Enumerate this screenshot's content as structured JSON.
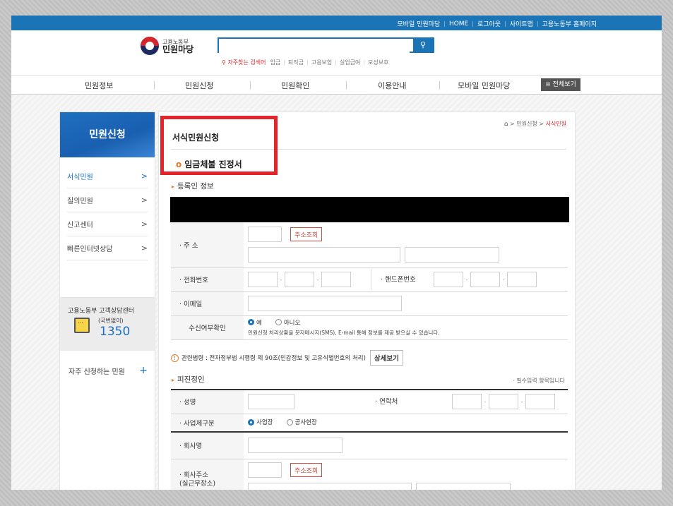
{
  "topbar": {
    "links": [
      "모바일 민원마당",
      "HOME",
      "로그아웃",
      "사이트맵",
      "고용노동부 홈페이지"
    ]
  },
  "logo": {
    "line1": "고용노동부",
    "line2": "민원마당"
  },
  "search": {
    "value": "",
    "button_icon": "search-icon",
    "hot_label": "자주찾는 검색어",
    "keywords": [
      "임금",
      "퇴직금",
      "고용보험",
      "실업급여",
      "모성보호"
    ]
  },
  "gnb": {
    "items": [
      "민원정보",
      "민원신청",
      "민원확인",
      "이용안내",
      "모바일 민원마당"
    ],
    "all_label": "≡ 전체보기"
  },
  "lnb": {
    "title": "민원신청",
    "items": [
      {
        "label": "서식민원",
        "active": true
      },
      {
        "label": "질의민원",
        "active": false
      },
      {
        "label": "신고센터",
        "active": false
      },
      {
        "label": "빠른인터넷상담",
        "active": false
      }
    ],
    "center_title": "고용노동부 고객상담센터",
    "center_sub": "(국번없이)",
    "center_number": "1350",
    "frequent_label": "자주 신청하는 민원",
    "frequent_icon": "+"
  },
  "breadcrumb": {
    "items": [
      "민원신청",
      "서식민원"
    ]
  },
  "page_title": "서식민원신청",
  "form_title": "임금체불 진정서",
  "sections": {
    "registrant": "등록인 정보",
    "respondent": "피진정인",
    "required_note": "· 필수입력 항목입니다"
  },
  "registrant": {
    "address_label": "· 주 소",
    "address_button": "주소조회",
    "phone_label": "· 전화번호",
    "mobile_label": "· 핸드폰번호",
    "email_label": "· 이메일",
    "receive_label": "수신여부확인",
    "receive_options": [
      "예",
      "아니오"
    ],
    "receive_selected": "예",
    "receive_note": "민원신청 처리상황을 문자메시지(SMS), E-mail 통해 정보를 제공 받으실 수 있습니다."
  },
  "notice": {
    "text": "관련법령 : 전자정부법 시행령 제 90조(민감정보 및 고유식별번호의 처리)",
    "button": "상세보기"
  },
  "respondent": {
    "name_label": "· 성명",
    "contact_label": "· 연락처",
    "biz_type_label": "· 사업체구분",
    "biz_type_options": [
      "사업장",
      "공사현장"
    ],
    "biz_type_selected": "사업장",
    "company_label": "· 회사명",
    "company_address_label": "· 회사주소",
    "company_address_sub": "(실근무장소)",
    "address_button": "주소조회"
  },
  "colors": {
    "accent": "#1b74b6",
    "highlight": "#e3242b",
    "orange": "#e27a26"
  }
}
